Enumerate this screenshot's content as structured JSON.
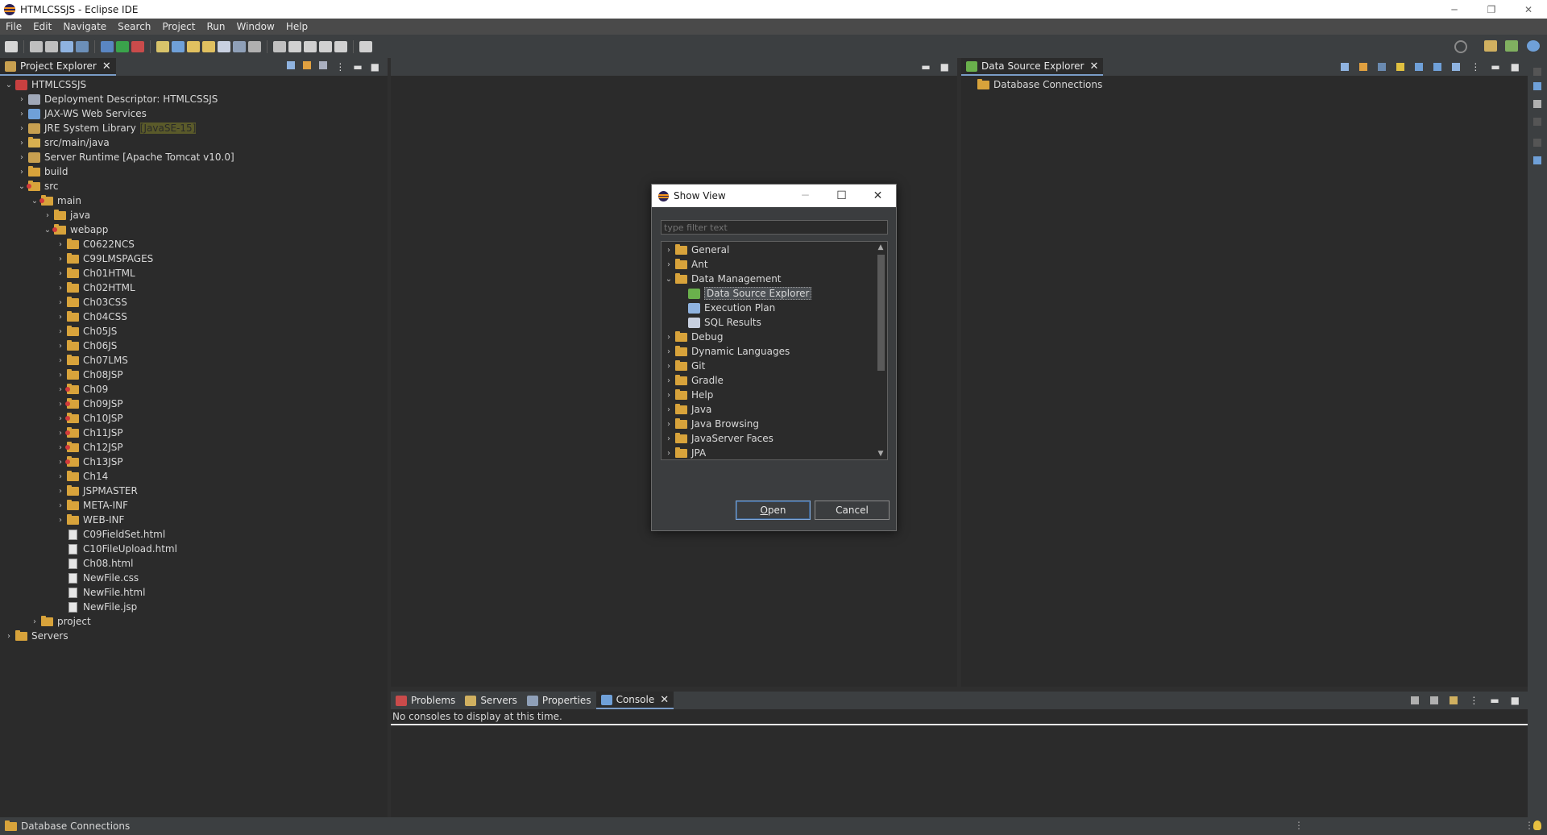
{
  "window": {
    "title": "HTMLCSSJS - Eclipse IDE",
    "controls": [
      "─",
      "❐",
      "✕"
    ]
  },
  "menu": [
    "File",
    "Edit",
    "Navigate",
    "Search",
    "Project",
    "Run",
    "Window",
    "Help"
  ],
  "project_explorer": {
    "tab_label": "Project Explorer",
    "items": [
      {
        "label": "HTMLCSSJS",
        "indent": 0,
        "chev": "v",
        "icon": "project"
      },
      {
        "label": "Deployment Descriptor: HTMLCSSJS",
        "indent": 1,
        "chev": ">",
        "icon": "descriptor"
      },
      {
        "label": "JAX-WS Web Services",
        "indent": 1,
        "chev": ">",
        "icon": "ws"
      },
      {
        "label": "JRE System Library",
        "suffix": "[JavaSE-15]",
        "indent": 1,
        "chev": ">",
        "icon": "library"
      },
      {
        "label": "src/main/java",
        "indent": 1,
        "chev": ">",
        "icon": "srcfolder"
      },
      {
        "label": "Server Runtime [Apache Tomcat v10.0]",
        "indent": 1,
        "chev": ">",
        "icon": "library"
      },
      {
        "label": "build",
        "indent": 1,
        "chev": ">",
        "icon": "folder"
      },
      {
        "label": "src",
        "indent": 1,
        "chev": "v",
        "icon": "folder-red"
      },
      {
        "label": "main",
        "indent": 2,
        "chev": "v",
        "icon": "folder-red"
      },
      {
        "label": "java",
        "indent": 3,
        "chev": ">",
        "icon": "folder"
      },
      {
        "label": "webapp",
        "indent": 3,
        "chev": "v",
        "icon": "folder-red"
      },
      {
        "label": "C0622NCS",
        "indent": 4,
        "chev": ">",
        "icon": "folder"
      },
      {
        "label": "C99LMSPAGES",
        "indent": 4,
        "chev": ">",
        "icon": "folder"
      },
      {
        "label": "Ch01HTML",
        "indent": 4,
        "chev": ">",
        "icon": "folder"
      },
      {
        "label": "Ch02HTML",
        "indent": 4,
        "chev": ">",
        "icon": "folder"
      },
      {
        "label": "Ch03CSS",
        "indent": 4,
        "chev": ">",
        "icon": "folder"
      },
      {
        "label": "Ch04CSS",
        "indent": 4,
        "chev": ">",
        "icon": "folder"
      },
      {
        "label": "Ch05JS",
        "indent": 4,
        "chev": ">",
        "icon": "folder"
      },
      {
        "label": "Ch06JS",
        "indent": 4,
        "chev": ">",
        "icon": "folder"
      },
      {
        "label": "Ch07LMS",
        "indent": 4,
        "chev": ">",
        "icon": "folder"
      },
      {
        "label": "Ch08JSP",
        "indent": 4,
        "chev": ">",
        "icon": "folder"
      },
      {
        "label": "Ch09",
        "indent": 4,
        "chev": ">",
        "icon": "folder-red"
      },
      {
        "label": "Ch09JSP",
        "indent": 4,
        "chev": ">",
        "icon": "folder-red"
      },
      {
        "label": "Ch10JSP",
        "indent": 4,
        "chev": ">",
        "icon": "folder-red"
      },
      {
        "label": "Ch11JSP",
        "indent": 4,
        "chev": ">",
        "icon": "folder-red"
      },
      {
        "label": "Ch12JSP",
        "indent": 4,
        "chev": ">",
        "icon": "folder-red"
      },
      {
        "label": "Ch13JSP",
        "indent": 4,
        "chev": ">",
        "icon": "folder-red"
      },
      {
        "label": "Ch14",
        "indent": 4,
        "chev": ">",
        "icon": "folder"
      },
      {
        "label": "JSPMASTER",
        "indent": 4,
        "chev": ">",
        "icon": "folder"
      },
      {
        "label": "META-INF",
        "indent": 4,
        "chev": ">",
        "icon": "folder"
      },
      {
        "label": "WEB-INF",
        "indent": 4,
        "chev": ">",
        "icon": "folder"
      },
      {
        "label": "C09FieldSet.html",
        "indent": 4,
        "chev": "",
        "icon": "file"
      },
      {
        "label": "C10FileUpload.html",
        "indent": 4,
        "chev": "",
        "icon": "file"
      },
      {
        "label": "Ch08.html",
        "indent": 4,
        "chev": "",
        "icon": "file"
      },
      {
        "label": "NewFile.css",
        "indent": 4,
        "chev": "",
        "icon": "file"
      },
      {
        "label": "NewFile.html",
        "indent": 4,
        "chev": "",
        "icon": "file"
      },
      {
        "label": "NewFile.jsp",
        "indent": 4,
        "chev": "",
        "icon": "file"
      },
      {
        "label": "project",
        "indent": 2,
        "chev": ">",
        "icon": "folder"
      },
      {
        "label": "Servers",
        "indent": 0,
        "chev": ">",
        "icon": "folder-blue"
      }
    ]
  },
  "data_source_explorer": {
    "tab_label": "Data Source Explorer",
    "items": [
      "Database Connections"
    ]
  },
  "bottom_panel": {
    "tabs": [
      "Problems",
      "Servers",
      "Properties",
      "Console"
    ],
    "active_tab": "Console",
    "message": "No consoles to display at this time."
  },
  "dialog": {
    "title": "Show View",
    "filter_placeholder": "type filter text",
    "items": [
      {
        "label": "General",
        "level": 0,
        "chev": ">",
        "icon": "folder"
      },
      {
        "label": "Ant",
        "level": 0,
        "chev": ">",
        "icon": "folder"
      },
      {
        "label": "Data Management",
        "level": 0,
        "chev": "v",
        "icon": "folder-open"
      },
      {
        "label": "Data Source Explorer",
        "level": 1,
        "chev": "",
        "icon": "dse",
        "selected": true
      },
      {
        "label": "Execution Plan",
        "level": 1,
        "chev": "",
        "icon": "plan"
      },
      {
        "label": "SQL Results",
        "level": 1,
        "chev": "",
        "icon": "sql"
      },
      {
        "label": "Debug",
        "level": 0,
        "chev": ">",
        "icon": "folder"
      },
      {
        "label": "Dynamic Languages",
        "level": 0,
        "chev": ">",
        "icon": "folder"
      },
      {
        "label": "Git",
        "level": 0,
        "chev": ">",
        "icon": "folder"
      },
      {
        "label": "Gradle",
        "level": 0,
        "chev": ">",
        "icon": "folder"
      },
      {
        "label": "Help",
        "level": 0,
        "chev": ">",
        "icon": "folder"
      },
      {
        "label": "Java",
        "level": 0,
        "chev": ">",
        "icon": "folder"
      },
      {
        "label": "Java Browsing",
        "level": 0,
        "chev": ">",
        "icon": "folder"
      },
      {
        "label": "JavaServer Faces",
        "level": 0,
        "chev": ">",
        "icon": "folder"
      },
      {
        "label": "JPA",
        "level": 0,
        "chev": ">",
        "icon": "folder"
      }
    ],
    "open_label": "Open",
    "open_mnemonic": "O",
    "open_rest": "pen",
    "cancel_label": "Cancel"
  },
  "status_bar": {
    "text": "Database Connections"
  },
  "colors": {
    "accent": "#7a9cc7",
    "folder": "#d8a33b",
    "selection": "#4b4f53"
  }
}
